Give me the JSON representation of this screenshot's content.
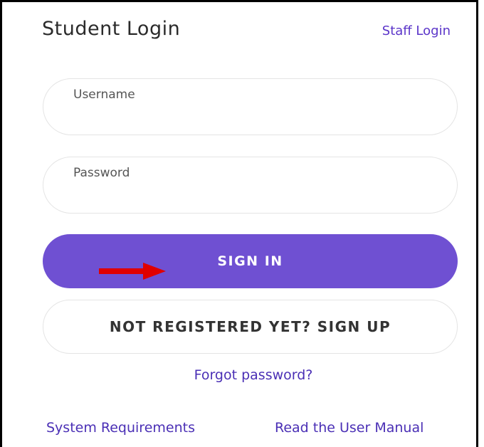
{
  "header": {
    "title": "Student Login",
    "staff_login": "Staff Login"
  },
  "form": {
    "username_label": "Username",
    "username_value": "",
    "password_label": "Password",
    "password_value": ""
  },
  "buttons": {
    "sign_in": "SIGN IN",
    "sign_up": "NOT REGISTERED YET? SIGN UP"
  },
  "links": {
    "forgot_password": "Forgot password?",
    "system_requirements": "System Requirements",
    "user_manual": "Read the User Manual"
  },
  "annotation": {
    "icon": "red-arrow-right-icon",
    "color": "#e00000"
  },
  "colors": {
    "primary": "#6f50d2",
    "link": "#4a2fb5",
    "field_border": "#e4e4e4"
  }
}
